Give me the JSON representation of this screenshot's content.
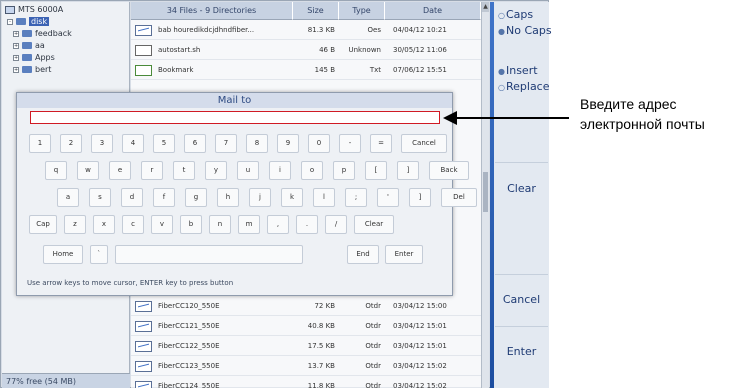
{
  "tree": {
    "items": [
      {
        "label": "MTS 6000A",
        "icon": "device-icon"
      },
      {
        "label": "disk",
        "icon": "folder-icon",
        "selected": true
      },
      {
        "label": "feedback",
        "icon": "folder-icon"
      },
      {
        "label": "aa",
        "icon": "folder-icon"
      },
      {
        "label": "Apps",
        "icon": "folder-icon"
      },
      {
        "label": "bert",
        "icon": "folder-icon"
      }
    ],
    "free_space": "77% free (54 MB)"
  },
  "files": {
    "header": {
      "name": "34 Files - 9 Directories",
      "size": "Size",
      "type": "Type",
      "date": "Date"
    },
    "rows": [
      {
        "icon": "fiber-file-icon",
        "name": "bab houredikdcjdhndfiber...",
        "size": "81.3 KB",
        "type": "Oes",
        "date": "04/04/12 10:21"
      },
      {
        "icon": "script-file-icon",
        "name": "autostart.sh",
        "size": "46 B",
        "type": "Unknown",
        "date": "30/05/12 11:06"
      },
      {
        "icon": "bookmark-file-icon",
        "name": "Bookmark",
        "size": "145 B",
        "type": "Txt",
        "date": "07/06/12 15:51"
      },
      {
        "icon": "fiber-file-icon",
        "name": "FiberCC120_550E",
        "size": "72 KB",
        "type": "Otdr",
        "date": "03/04/12 15:00"
      },
      {
        "icon": "fiber-file-icon",
        "name": "FiberCC121_550E",
        "size": "40.8 KB",
        "type": "Otdr",
        "date": "03/04/12 15:01"
      },
      {
        "icon": "fiber-file-icon",
        "name": "FiberCC122_550E",
        "size": "17.5 KB",
        "type": "Otdr",
        "date": "03/04/12 15:01"
      },
      {
        "icon": "fiber-file-icon",
        "name": "FiberCC123_550E",
        "size": "13.7 KB",
        "type": "Otdr",
        "date": "03/04/12 15:02"
      },
      {
        "icon": "fiber-file-icon",
        "name": "FiberCC124_550E",
        "size": "11.8 KB",
        "type": "Otdr",
        "date": "03/04/12 15:02"
      }
    ]
  },
  "side_panel": {
    "caps_group": [
      "Caps",
      "No Caps"
    ],
    "mode_group": [
      "Insert",
      "Replace"
    ],
    "buttons": [
      "Clear",
      "Cancel",
      "Enter"
    ]
  },
  "dialog": {
    "title": "Mail to",
    "input_value": "",
    "help": "Use arrow keys to move cursor, ENTER key to press button",
    "keys": [
      [
        "1",
        "2",
        "3",
        "4",
        "5",
        "6",
        "7",
        "8",
        "9",
        "0",
        "-",
        "=",
        "Cancel"
      ],
      [
        "q",
        "w",
        "e",
        "r",
        "t",
        "y",
        "u",
        "i",
        "o",
        "p",
        "[",
        "]",
        "Back"
      ],
      [
        "a",
        "s",
        "d",
        "f",
        "g",
        "h",
        "j",
        "k",
        "l",
        ";",
        "'",
        "]",
        "Del"
      ],
      [
        "Cap",
        "z",
        "x",
        "c",
        "v",
        "b",
        "n",
        "m",
        ",",
        ".",
        "/",
        "Clear"
      ],
      [
        "Home",
        "`",
        "",
        "End",
        "Enter"
      ]
    ]
  },
  "annotation": {
    "text_line1": "Введите адрес",
    "text_line2": "электронной почты"
  },
  "colors": {
    "accent": "#3c63b4",
    "input_border": "#d01a24",
    "panel_blue": "#1d4ea0"
  }
}
